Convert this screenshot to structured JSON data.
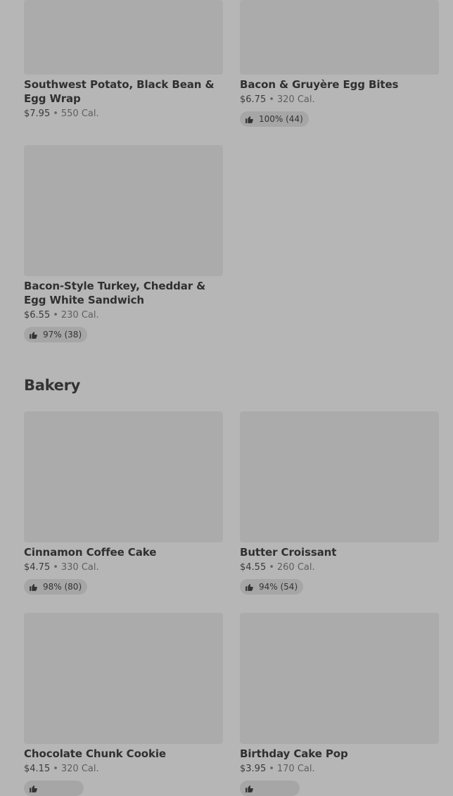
{
  "items": [
    {
      "name": "Southwest Potato, Black Bean & Egg Wrap",
      "price": "$7.95",
      "calories": "550 Cal."
    },
    {
      "name": "Bacon & Gruyère Egg Bites",
      "price": "$6.75",
      "calories": "320 Cal.",
      "rating": "100% (44)"
    },
    {
      "name": "Bacon-Style Turkey, Cheddar & Egg White Sandwich",
      "price": "$6.55",
      "calories": "230 Cal.",
      "rating": "97% (38)"
    }
  ],
  "bakery": {
    "title": "Bakery",
    "items": [
      {
        "name": "Cinnamon Coffee Cake",
        "price": "$4.75",
        "calories": "330 Cal.",
        "rating": "98% (80)"
      },
      {
        "name": "Butter Croissant",
        "price": "$4.55",
        "calories": "260 Cal.",
        "rating": "94% (54)"
      },
      {
        "name": "Chocolate Chunk Cookie",
        "price": "$4.15",
        "calories": "320 Cal.",
        "rating": ""
      },
      {
        "name": "Birthday Cake Pop",
        "price": "$3.95",
        "calories": "170 Cal.",
        "rating": ""
      }
    ]
  },
  "icons": {
    "rating": "thumbs-up-icon"
  },
  "colors": {
    "background": "#b6b6b6",
    "image_placeholder": "#ababab",
    "badge": "#a6a6a6"
  }
}
